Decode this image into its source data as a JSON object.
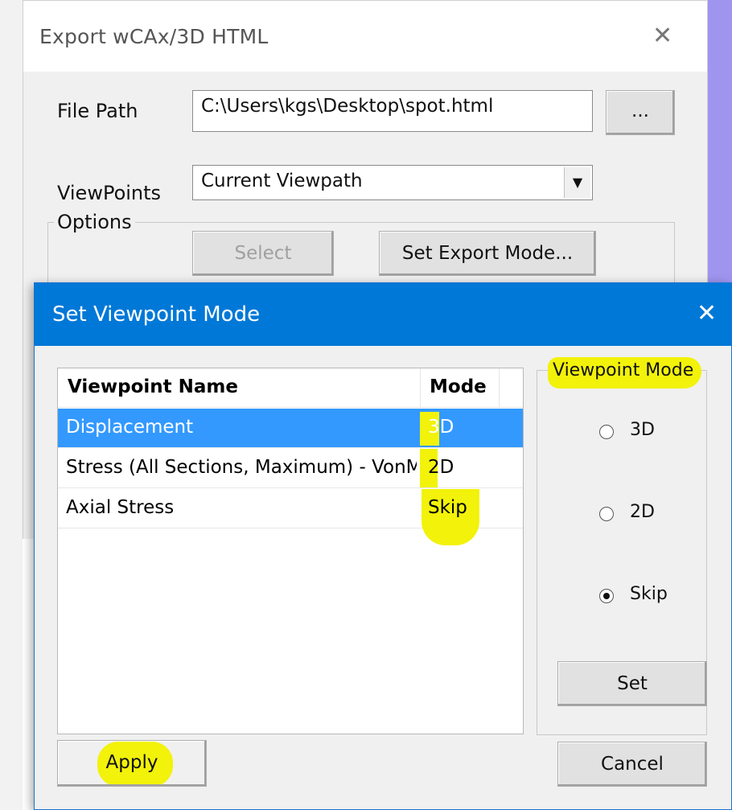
{
  "export_dialog": {
    "title": "Export wCAx/3D HTML",
    "close_glyph": "✕",
    "file_path_label": "File Path",
    "file_path_value": "C:\\Users\\kgs\\Desktop\\spot.html",
    "browse_label": "...",
    "viewpoints_label": "ViewPoints",
    "viewpoints_value": "Current Viewpath",
    "options_label": "Options",
    "select_label": "Select",
    "set_export_mode_label": "Set Export Mode..."
  },
  "viewpoint_dialog": {
    "title": "Set Viewpoint Mode",
    "close_glyph": "✕",
    "list": {
      "columns": [
        "Viewpoint Name",
        "Mode"
      ],
      "rows": [
        {
          "name": "Displacement",
          "mode": "3D",
          "selected": true
        },
        {
          "name": "Stress (All Sections, Maximum) - VonMises",
          "mode": "2D",
          "selected": false
        },
        {
          "name": "Axial Stress",
          "mode": "Skip",
          "selected": false
        }
      ]
    },
    "mode_group": {
      "label": "Viewpoint Mode",
      "options": [
        "3D",
        "2D",
        "Skip"
      ],
      "selected": "Skip"
    },
    "set_label": "Set",
    "apply_label": "Apply",
    "cancel_label": "Cancel"
  },
  "colors": {
    "titlebar_blue": "#0078d7",
    "selection_blue": "#3399ff",
    "highlight_yellow": "#f2f20a"
  }
}
